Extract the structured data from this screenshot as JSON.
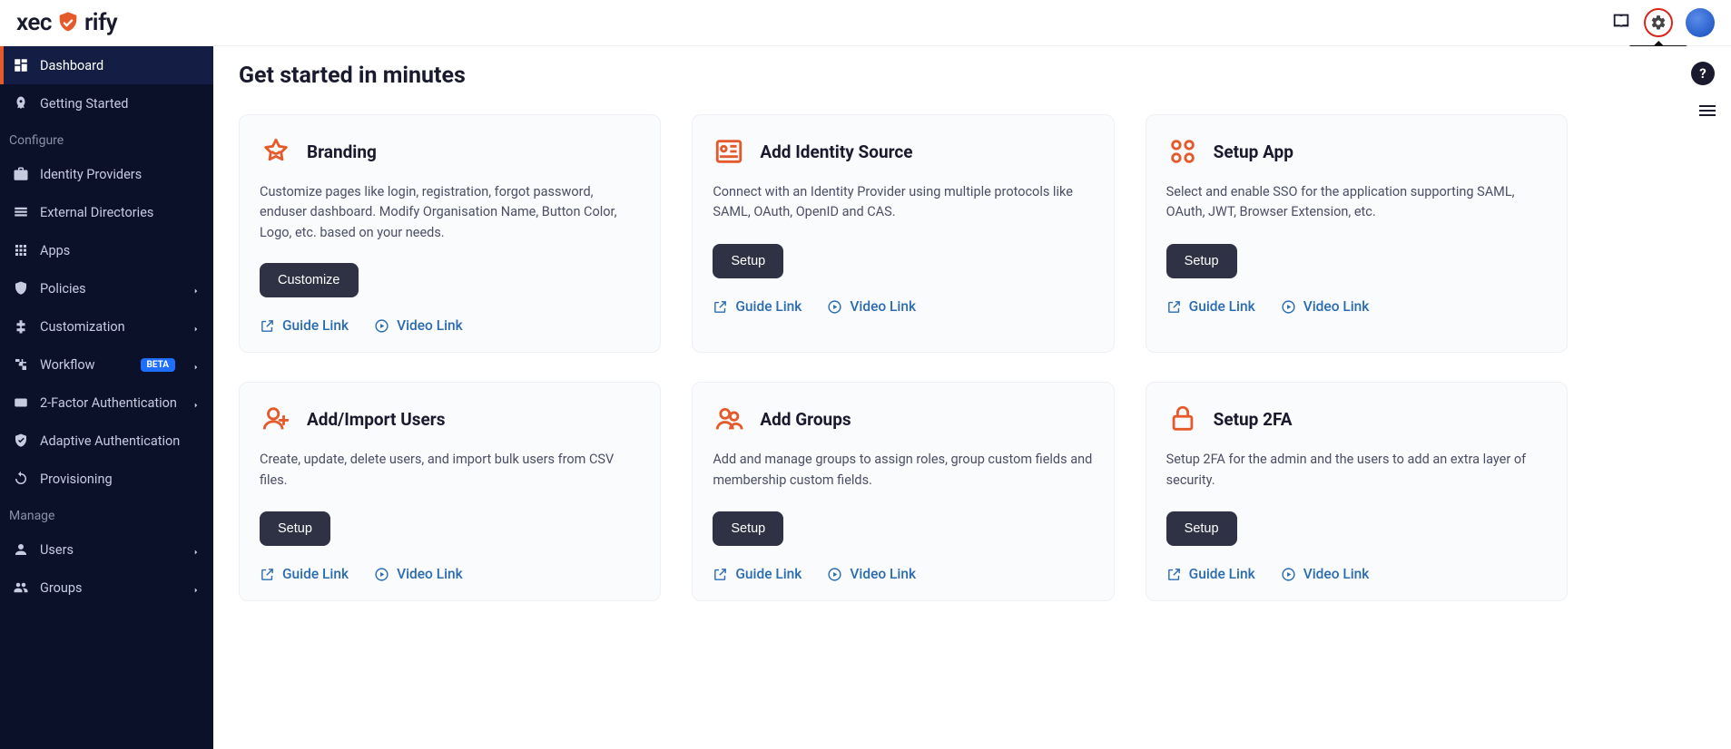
{
  "brand": "xecurify",
  "tooltip": "Settings",
  "sidebar": {
    "items": [
      {
        "label": "Dashboard"
      },
      {
        "label": "Getting Started"
      }
    ],
    "section_configure": "Configure",
    "configure": [
      {
        "label": "Identity Providers"
      },
      {
        "label": "External Directories"
      },
      {
        "label": "Apps"
      },
      {
        "label": "Policies",
        "expand": true
      },
      {
        "label": "Customization",
        "expand": true
      },
      {
        "label": "Workflow",
        "beta": "BETA",
        "expand": true
      },
      {
        "label": "2-Factor Authentication",
        "expand": true
      },
      {
        "label": "Adaptive Authentication"
      },
      {
        "label": "Provisioning"
      }
    ],
    "section_manage": "Manage",
    "manage": [
      {
        "label": "Users",
        "expand": true
      },
      {
        "label": "Groups",
        "expand": true
      }
    ]
  },
  "page_title": "Get started in minutes",
  "guide_label": "Guide Link",
  "video_label": "Video Link",
  "cards": [
    {
      "title": "Branding",
      "desc": "Customize pages like login, registration, forgot password, enduser dashboard. Modify Organisation Name, Button Color, Logo, etc. based on your needs.",
      "button": "Customize"
    },
    {
      "title": "Add Identity Source",
      "desc": "Connect with an Identity Provider using multiple protocols like SAML, OAuth, OpenID and CAS.",
      "button": "Setup"
    },
    {
      "title": "Setup App",
      "desc": "Select and enable SSO for the application supporting SAML, OAuth, JWT, Browser Extension, etc.",
      "button": "Setup"
    },
    {
      "title": "Add/Import Users",
      "desc": "Create, update, delete users, and import bulk users from CSV files.",
      "button": "Setup"
    },
    {
      "title": "Add Groups",
      "desc": "Add and manage groups to assign roles, group custom fields and membership custom fields.",
      "button": "Setup"
    },
    {
      "title": "Setup 2FA",
      "desc": "Setup 2FA for the admin and the users to add an extra layer of security.",
      "button": "Setup"
    }
  ]
}
